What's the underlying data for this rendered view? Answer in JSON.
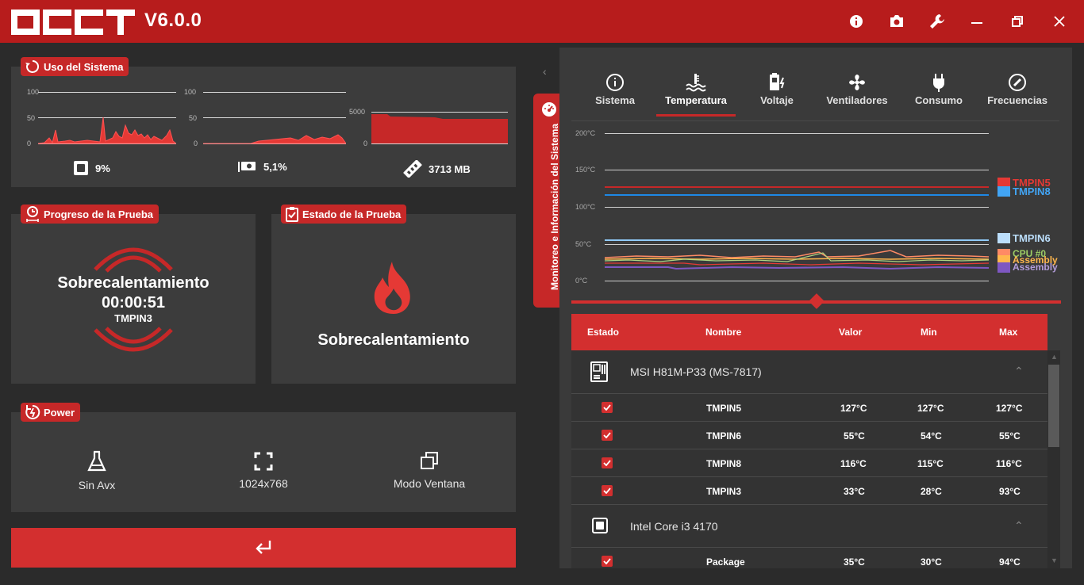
{
  "app": {
    "title": "OCCT",
    "version": "V6.0.0",
    "accent": "#b71c1c",
    "window_buttons": [
      "info-icon",
      "camera-icon",
      "wrench-icon",
      "minimize-icon",
      "restore-icon",
      "close-icon"
    ]
  },
  "usage": {
    "title": "Uso del Sistema",
    "cpu_axis": [
      "100",
      "50",
      "0"
    ],
    "gpu_axis": [
      "100",
      "50",
      "0"
    ],
    "mem_axis": [
      "5000",
      "0"
    ],
    "cpu_value": "9%",
    "gpu_value": "5,1%",
    "mem_value": "3713 MB"
  },
  "progress": {
    "title": "Progreso de la Prueba",
    "test": "Sobrecalentamiento",
    "time": "00:00:51",
    "sensor": "TMPIN3"
  },
  "status": {
    "title": "Estado de la Prueba",
    "text": "Sobrecalentamiento"
  },
  "power": {
    "title": "Power",
    "items": [
      {
        "icon": "flask-icon",
        "label": "Sin Avx"
      },
      {
        "icon": "fullscreen-icon",
        "label": "1024x768"
      },
      {
        "icon": "window-icon",
        "label": "Modo Ventana"
      }
    ]
  },
  "start_button": {
    "icon": "enter-icon"
  },
  "side_tab": {
    "label": "Monitoreo e Información del Sistema"
  },
  "monitor": {
    "tabs": [
      {
        "label": "Sistema",
        "icon": "info-icon"
      },
      {
        "label": "Temperatura",
        "icon": "thermometer-icon",
        "active": true
      },
      {
        "label": "Voltaje",
        "icon": "battery-bolt-icon"
      },
      {
        "label": "Ventiladores",
        "icon": "fan-icon"
      },
      {
        "label": "Consumo",
        "icon": "plug-icon"
      },
      {
        "label": "Frecuencias",
        "icon": "gauge-icon"
      }
    ],
    "chart": {
      "y_ticks": [
        "200°C",
        "150°C",
        "100°C",
        "50°C",
        "0°C"
      ],
      "legend": {
        "tmpin5": "TMPIN5",
        "tmpin8": "TMPIN8",
        "tmpin6": "TMPIN6",
        "overlap_a": "CPU #0",
        "overlap_b": "Assembly",
        "overlap_c": "Assembly"
      }
    },
    "table": {
      "headers": {
        "estado": "Estado",
        "nombre": "Nombre",
        "valor": "Valor",
        "min": "Min",
        "max": "Max"
      },
      "group1": "MSI H81M-P33 (MS-7817)",
      "group2": "Intel Core i3 4170",
      "rows": [
        {
          "name": "TMPIN5",
          "valor": "127°C",
          "min": "127°C",
          "max": "127°C"
        },
        {
          "name": "TMPIN6",
          "valor": "55°C",
          "min": "54°C",
          "max": "55°C"
        },
        {
          "name": "TMPIN8",
          "valor": "116°C",
          "min": "115°C",
          "max": "116°C"
        },
        {
          "name": "TMPIN3",
          "valor": "33°C",
          "min": "28°C",
          "max": "93°C"
        },
        {
          "name": "Package",
          "valor": "35°C",
          "min": "30°C",
          "max": "94°C"
        }
      ]
    }
  }
}
